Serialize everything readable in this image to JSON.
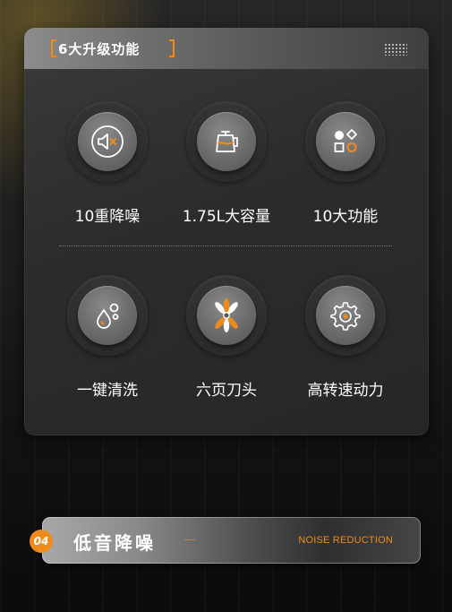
{
  "card": {
    "title": "6大升级功能",
    "icon": "dots-grid-icon"
  },
  "features": [
    {
      "label": "10重降噪",
      "icon": "mute-speaker-icon"
    },
    {
      "label": "1.75L大容量",
      "icon": "jug-icon"
    },
    {
      "label": "10大功能",
      "icon": "shapes-icon"
    },
    {
      "label": "一键清洗",
      "icon": "water-drops-icon"
    },
    {
      "label": "六页刀头",
      "icon": "blade-icon"
    },
    {
      "label": "高转速动力",
      "icon": "gear-icon"
    }
  ],
  "section": {
    "number": "04",
    "title": "低音降噪",
    "subtitle_en": "NOISE REDUCTION"
  },
  "colors": {
    "accent": "#f08a1c",
    "icon_stroke": "#ffffff"
  }
}
